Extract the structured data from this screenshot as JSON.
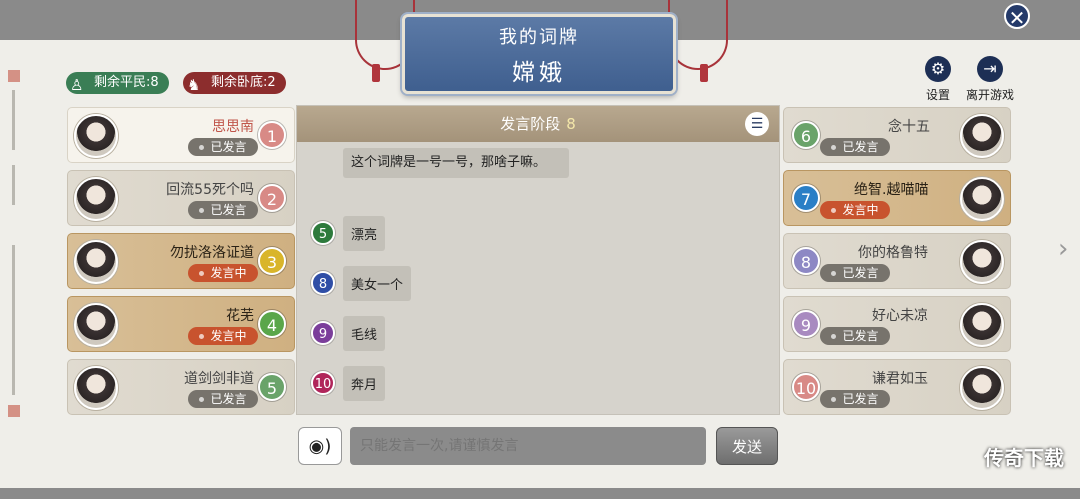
{
  "header": {
    "title": "我的词牌",
    "word": "嫦娥"
  },
  "counters": {
    "civilians": "剩余平民:8",
    "undercover": "剩余卧底:2"
  },
  "system": {
    "settings": "设置",
    "leave": "离开游戏"
  },
  "chat": {
    "phase_label": "发言阶段",
    "phase_count": "8",
    "messages": [
      {
        "num": "",
        "text": "这个词牌是一号一号，那啥子嘛。"
      },
      {
        "num": "5",
        "text": "漂亮"
      },
      {
        "num": "8",
        "text": "美女一个"
      },
      {
        "num": "9",
        "text": "毛线"
      },
      {
        "num": "10",
        "text": "奔月"
      }
    ]
  },
  "left_players": [
    {
      "num": "1",
      "name": "思思南",
      "status": "已发言",
      "color": "#d88a86"
    },
    {
      "num": "2",
      "name": "回流55死个吗",
      "status": "已发言",
      "color": "#d88a86"
    },
    {
      "num": "3",
      "name": "勿扰洛洛证道",
      "status": "发言中",
      "color": "#d9b52a"
    },
    {
      "num": "4",
      "name": "花芜",
      "status": "发言中",
      "color": "#5aa64a"
    },
    {
      "num": "5",
      "name": "道剑剑非道",
      "status": "已发言",
      "color": "#6aa36a"
    }
  ],
  "right_players": [
    {
      "num": "6",
      "name": "念十五",
      "status": "已发言",
      "color": "#6aa36a"
    },
    {
      "num": "7",
      "name": "绝智.越喵喵",
      "status": "发言中",
      "color": "#2a7fc6"
    },
    {
      "num": "8",
      "name": "你的格鲁特",
      "status": "已发言",
      "color": "#8d88c4"
    },
    {
      "num": "9",
      "name": "好心未凉",
      "status": "已发言",
      "color": "#a88ac0"
    },
    {
      "num": "10",
      "name": "谦君如玉",
      "status": "已发言",
      "color": "#d88a86"
    }
  ],
  "message_colors": [
    "#2d7a3c",
    "#2f4ea6",
    "#7b3e9a",
    "#b0255a"
  ],
  "input": {
    "placeholder": "只能发言一次,请谨慎发言",
    "send": "发送"
  },
  "watermark": "传奇下载"
}
